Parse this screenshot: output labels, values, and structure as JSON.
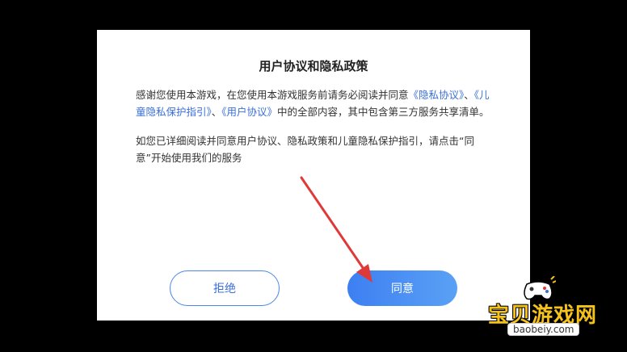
{
  "dialog": {
    "title": "用户协议和隐私政策",
    "para1_prefix": "感谢您使用本游戏，在您使用本游戏服务前请务必阅读并同意",
    "link_privacy": "《隐私协议》",
    "sep1": "、",
    "link_children": "《儿童隐私保护指引》",
    "sep2": "、",
    "link_user": "《用户协议》",
    "para1_suffix": "中的全部内容，其中包含第三方服务共享清单。",
    "para2": " 如您已详细阅读并同意用户协议、隐私政策和儿童隐私保护指引，请点击“同意”开始使用我们的服务",
    "refuse_label": "拒绝",
    "agree_label": "同意"
  },
  "watermark": {
    "text": "宝贝游戏网",
    "url": "baobeiy.com"
  },
  "colors": {
    "link": "#3a6fd8",
    "accent": "#4b86e8",
    "annotation_arrow": "#e0393a",
    "watermark": "#f5c21c"
  },
  "icons": [
    "gamepad-icon",
    "annotation-arrow"
  ]
}
